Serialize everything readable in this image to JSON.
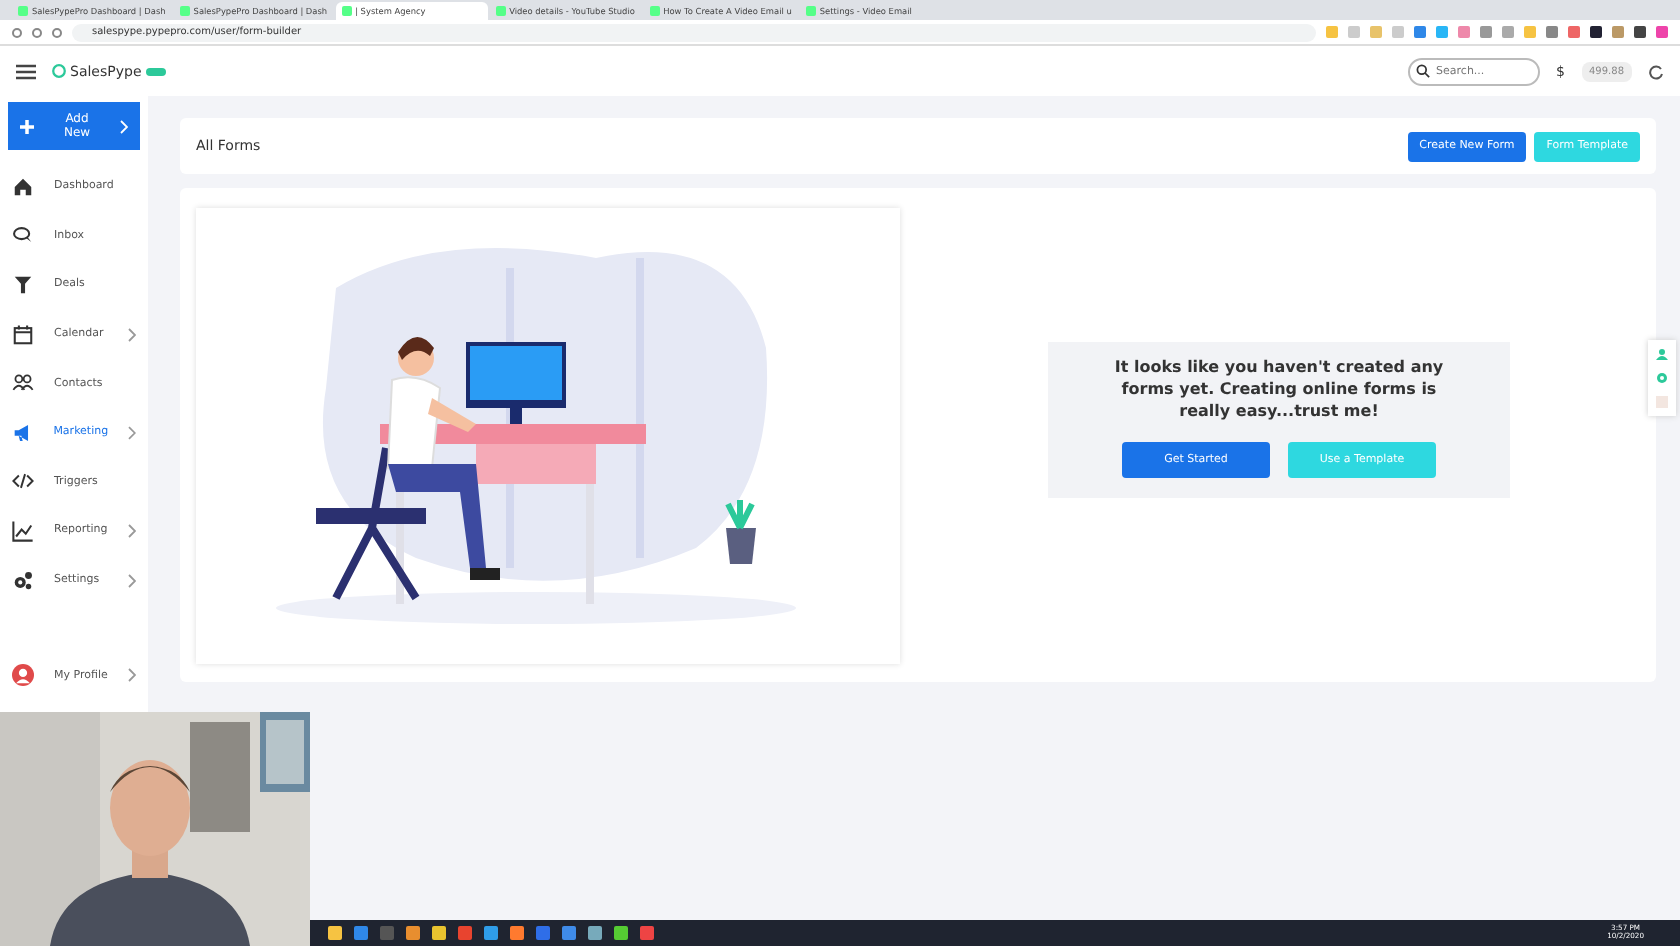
{
  "browser": {
    "tabs": [
      {
        "title": "SalesPypePro Dashboard | Dash",
        "selected": false
      },
      {
        "title": "SalesPypePro Dashboard | Dash",
        "selected": false
      },
      {
        "title": "| System Agency",
        "selected": true
      },
      {
        "title": "Video details - YouTube Studio",
        "selected": false
      },
      {
        "title": "How To Create A Video Email u",
        "selected": false
      },
      {
        "title": "Settings - Video Email",
        "selected": false
      }
    ],
    "url": "salespype.pypepro.com/user/form-builder"
  },
  "header": {
    "logo": "SalesPype",
    "search": {
      "placeholder": "Search..."
    },
    "currency": "$",
    "balance": "499.88"
  },
  "sidebar": {
    "add_new": "Add New",
    "items": [
      {
        "label": "Dashboard",
        "kind": "home",
        "selected": false,
        "submenu": false
      },
      {
        "label": "Inbox",
        "kind": "chat",
        "selected": false,
        "submenu": false
      },
      {
        "label": "Deals",
        "kind": "filter",
        "selected": false,
        "submenu": false
      },
      {
        "label": "Calendar",
        "kind": "calendar",
        "selected": false,
        "submenu": true
      },
      {
        "label": "Contacts",
        "kind": "people",
        "selected": false,
        "submenu": false
      },
      {
        "label": "Marketing",
        "kind": "megaphone",
        "selected": true,
        "submenu": true
      },
      {
        "label": "Triggers",
        "kind": "code",
        "selected": false,
        "submenu": false
      },
      {
        "label": "Reporting",
        "kind": "chart",
        "selected": false,
        "submenu": true
      },
      {
        "label": "Settings",
        "kind": "gears",
        "selected": false,
        "submenu": true
      }
    ],
    "profile": "My Profile"
  },
  "page": {
    "title": "All Forms",
    "buttons": [
      "Create New Form",
      "Form Template"
    ]
  },
  "empty_state": {
    "message": "It looks like you haven't created any forms yet. Creating online forms is really easy...trust me!",
    "buttons": [
      "Get Started",
      "Use a Template"
    ]
  },
  "taskbar": {
    "time": "3:57 PM",
    "date": "10/2/2020"
  }
}
